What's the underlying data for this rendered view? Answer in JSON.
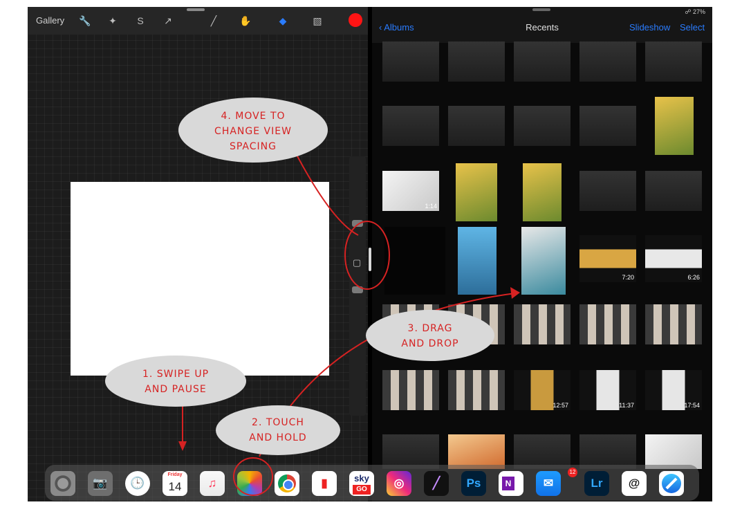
{
  "left_app": {
    "gallery_label": "Gallery",
    "tools": [
      "wrench-icon",
      "wand-icon",
      "selection-icon",
      "transform-icon",
      "brush-icon",
      "smudge-icon",
      "eraser-icon",
      "layers-icon"
    ],
    "color": "#ff1414"
  },
  "right_app": {
    "status": "☍ 27%",
    "back_label": "Albums",
    "title": "Recents",
    "slideshow_label": "Slideshow",
    "select_label": "Select",
    "durations": [
      "1:14",
      "7:20",
      "6:26",
      "12:57",
      "11:37",
      "17:54"
    ]
  },
  "dock": {
    "apps": [
      "Settings",
      "Camera",
      "Clock",
      "Calendar",
      "Music",
      "Photos",
      "Chrome",
      "Battery",
      "Sky Go",
      "Instagram",
      "Procreate",
      "Photoshop",
      "OneNote",
      "Mail",
      "Lightroom",
      "Threads",
      "Safari"
    ],
    "calendar_day": "Friday",
    "calendar_date": "14",
    "skygo_top": "sky",
    "skygo_bottom": "GO",
    "ps_label": "Ps",
    "lr_label": "Lr",
    "onenote_label": "N",
    "mail_badge": "12"
  },
  "annotations": {
    "step1_line1": "1. SWIPE UP",
    "step1_line2": "AND PAUSE",
    "step2_line1": "2. TOUCH",
    "step2_line2": "AND HOLD",
    "step3_line1": "3. DRAG",
    "step3_line2": "AND DROP",
    "step4_line1": "4. MOVE TO",
    "step4_line2": "CHANGE VIEW",
    "step4_line3": "SPACING",
    "color": "#d62222"
  }
}
